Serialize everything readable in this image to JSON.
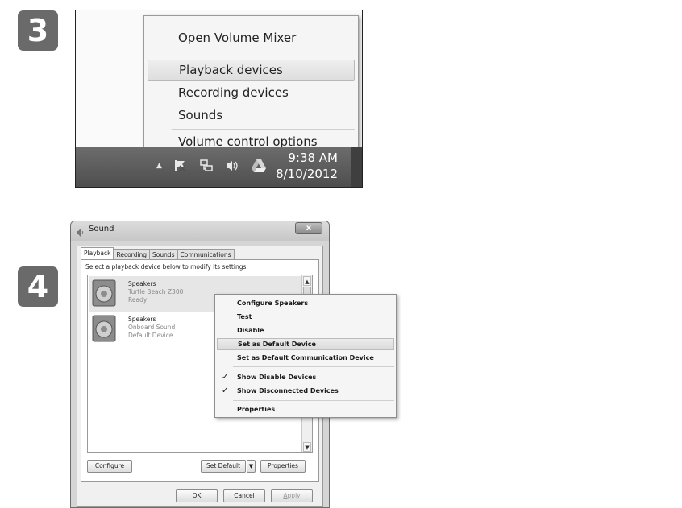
{
  "steps": {
    "first": "3",
    "second": "4"
  },
  "tray_menu": {
    "open_volume_mixer": "Open Volume Mixer",
    "playback_devices": "Playback devices",
    "recording_devices": "Recording devices",
    "sounds": "Sounds",
    "volume_control_options": "Volume control options",
    "highlighted_item": "Playback devices"
  },
  "taskbar": {
    "show_hidden_icon": "▲",
    "time": "9:38 AM",
    "date": "8/10/2012",
    "tray_icons": [
      "show-hidden-arrow-icon",
      "action-center-flag-icon",
      "network-icon",
      "speaker-volume-icon",
      "google-drive-icon"
    ]
  },
  "sound_dialog": {
    "title": "Sound",
    "close_label": "x",
    "tabs": [
      "Playback",
      "Recording",
      "Sounds",
      "Communications"
    ],
    "active_tab": "Playback",
    "instruction": "Select a playback device below to modify its settings:",
    "devices": [
      {
        "name": "Speakers",
        "description": "Turtle Beach Z300",
        "status": "Ready",
        "icon": "speaker-device-icon",
        "selected": true
      },
      {
        "name": "Speakers",
        "description": "Onboard Sound",
        "status": "Default Device",
        "icon": "speaker-device-icon",
        "selected": false
      }
    ],
    "buttons": {
      "configure": {
        "mnemonic": "C",
        "rest": "onfigure"
      },
      "set_default": {
        "mnemonic": "S",
        "rest": "et Default"
      },
      "properties": {
        "mnemonic": "P",
        "rest": "roperties"
      },
      "ok": "OK",
      "cancel": "Cancel",
      "apply": {
        "mnemonic": "A",
        "rest": "pply"
      },
      "split_arrow": "▼"
    }
  },
  "device_menu": {
    "configure_speakers": "Configure Speakers",
    "test": "Test",
    "disable": "Disable",
    "set_as_default_device": "Set as Default Device",
    "set_as_default_communication_device": "Set as Default Communication Device",
    "show_disabled_devices": "Show Disable Devices",
    "show_disconnected_devices": "Show Disconnected Devices",
    "properties": "Properties",
    "check_mark": "✓",
    "highlighted_item": "Set as Default Device"
  },
  "colors": {
    "badge": "#6a6a6a",
    "taskbar": "#565656",
    "menu_background": "#f5f5f5",
    "highlight": "#e2e2e2"
  }
}
